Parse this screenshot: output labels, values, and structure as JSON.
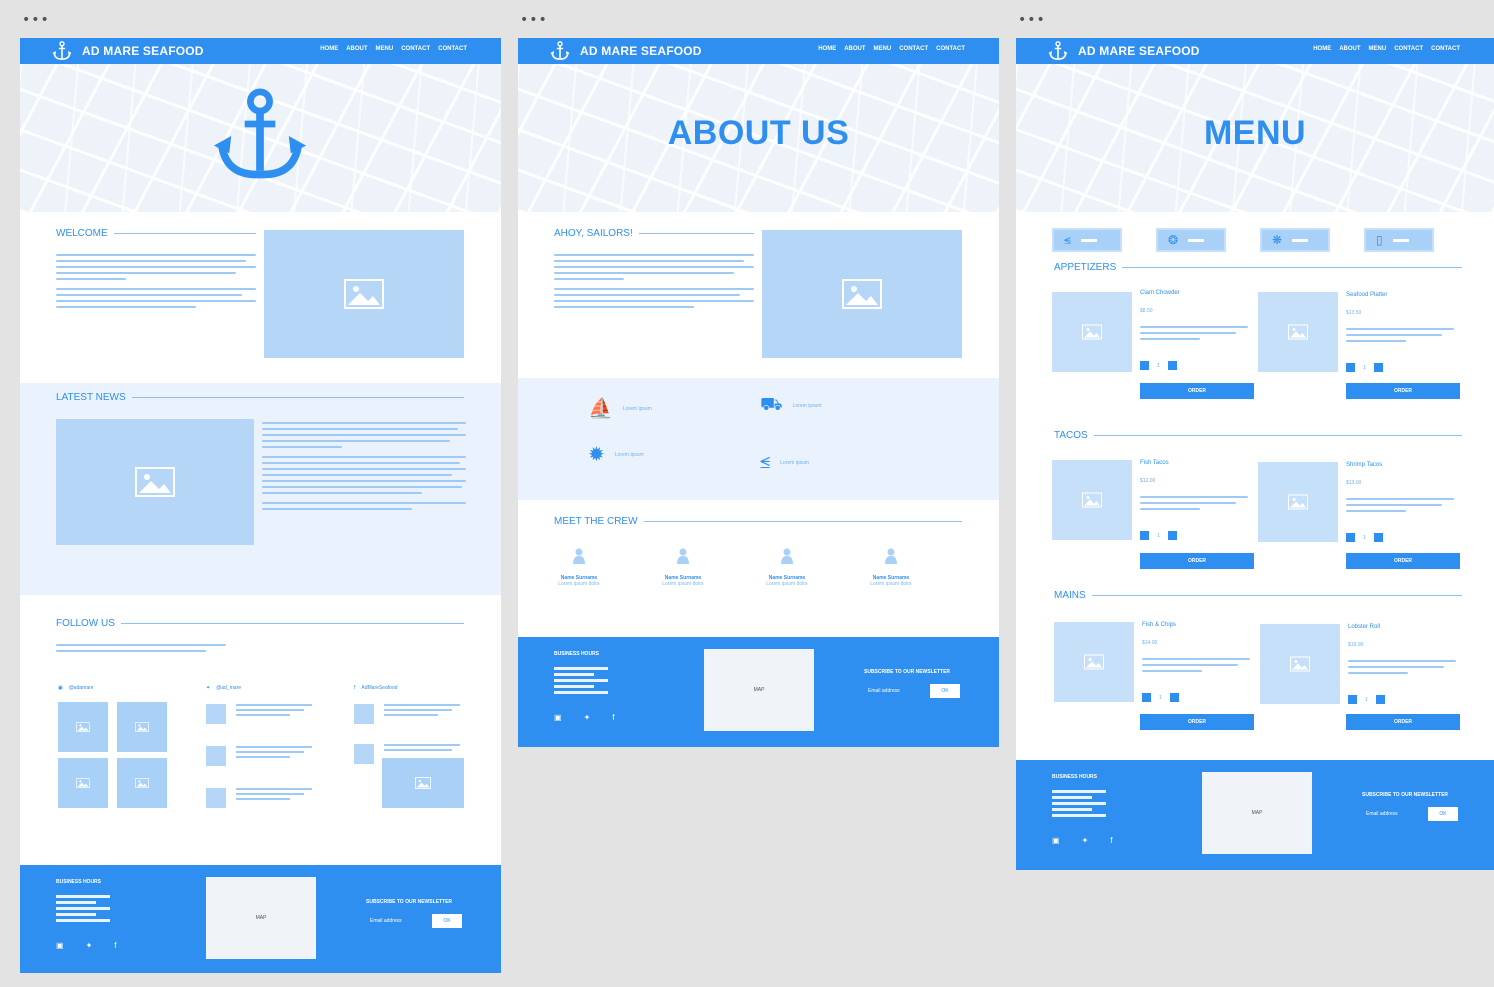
{
  "brand": "AD MARE SEAFOOD",
  "colors": {
    "primary": "#2e8ff0",
    "light": "#b5d6f7",
    "band": "#eaf3fd",
    "canvas": "#e3e3e3"
  },
  "window_dots": "•••",
  "nav_links": [
    "HOME",
    "ABOUT",
    "MENU",
    "CONTACT",
    "CONTACT"
  ],
  "home": {
    "welcome_title": "WELCOME",
    "news_title": "LATEST NEWS",
    "follow_title": "FOLLOW US",
    "social_handles": [
      "@adamare",
      "@ad_mare",
      "AdMareSeafood"
    ]
  },
  "about": {
    "hero_title": "ABOUT US",
    "section_title": "AHOY, SAILORS!",
    "features": [
      "Lorem ipsum",
      "Lorem ipsum",
      "Lorem ipsum",
      "Lorem ipsum"
    ],
    "crew_title": "MEET THE CREW",
    "crew": [
      {
        "name": "Name Surname",
        "role": "Lorem ipsum dolor"
      },
      {
        "name": "Name Surname",
        "role": "Lorem ipsum dolor"
      },
      {
        "name": "Name Surname",
        "role": "Lorem ipsum dolor"
      },
      {
        "name": "Name Surname",
        "role": "Lorem ipsum dolor"
      }
    ]
  },
  "menu": {
    "hero_title": "MENU",
    "categories": [
      {
        "title": "APPETIZERS",
        "dishes": [
          {
            "name": "Clam Chowder",
            "price": "$8.50"
          },
          {
            "name": "Seafood Platter",
            "price": "$13.50"
          }
        ]
      },
      {
        "title": "TACOS",
        "dishes": [
          {
            "name": "Fish Tacos",
            "price": "$12.00"
          },
          {
            "name": "Shrimp Tacos",
            "price": "$13.00"
          }
        ]
      },
      {
        "title": "MAINS",
        "dishes": [
          {
            "name": "Fish & Chips",
            "price": "$14.00"
          },
          {
            "name": "Lobster Roll",
            "price": "$19.00"
          }
        ]
      }
    ],
    "order_label": "ORDER",
    "qty_value": "1"
  },
  "footer": {
    "hours_title": "BUSINESS HOURS",
    "map_label": "MAP",
    "newsletter_title": "SUBSCRIBE TO OUR NEWSLETTER",
    "email_placeholder": "Email address",
    "ok_label": "OK",
    "social_icons": [
      "instagram-icon",
      "twitter-icon",
      "facebook-icon"
    ]
  }
}
